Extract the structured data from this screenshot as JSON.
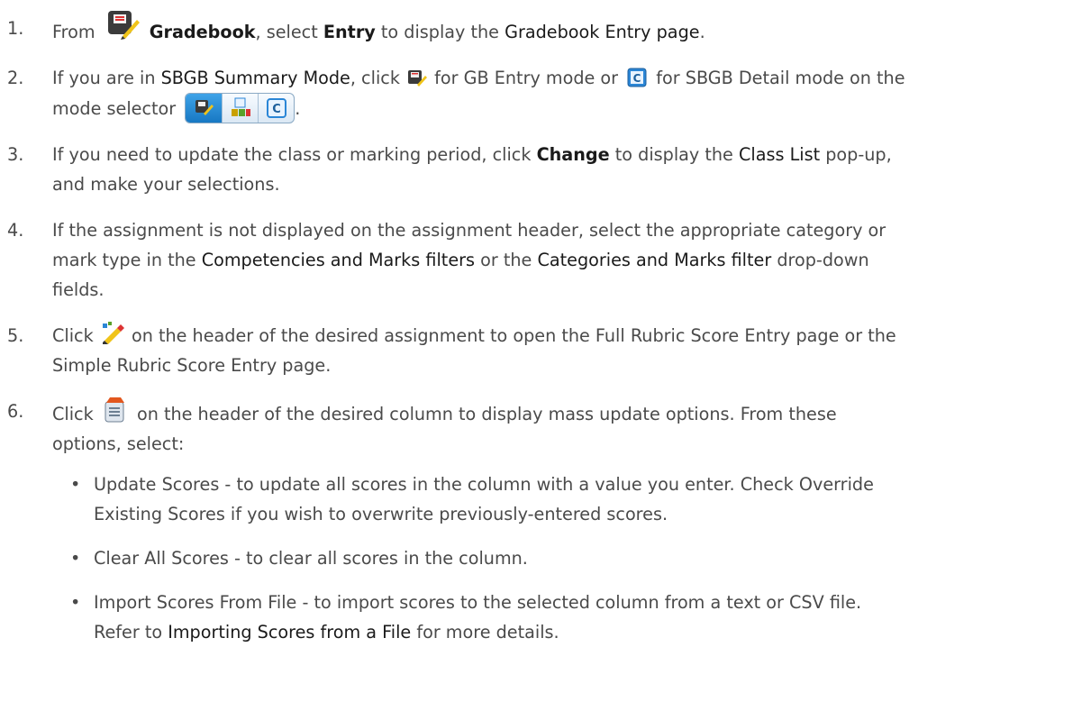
{
  "steps": [
    {
      "num": "1.",
      "from": "From",
      "gradebook": "Gradebook",
      "comma_select": ", select",
      "entry": "Entry",
      "to_display": "to display the",
      "page_link": "Gradebook Entry page",
      "end": "."
    },
    {
      "num": "2.",
      "if_in": "If you are in",
      "mode_link": "SBGB Summary Mode",
      "click": ", click",
      "for_gb": "for GB Entry mode or",
      "for_detail": "for SBGB Detail mode on the",
      "mode_selector": "mode selector",
      "end": "."
    },
    {
      "num": "3.",
      "line1a": "If you need to update the class or marking period, click",
      "change": "Change",
      "line1b": "to display the",
      "class_list": "Class List",
      "line1c": "pop-up,",
      "line2": "and make your selections."
    },
    {
      "num": "4.",
      "line1": "If the assignment is not displayed on the assignment header, select the appropriate category or",
      "line2a": "mark type in the",
      "comp_link": "Competencies and Marks filters",
      "or_the": "or the",
      "cat_link": "Categories and Marks filter",
      "line2b": "drop-down",
      "line3": "fields."
    },
    {
      "num": "5.",
      "click": "Click",
      "line1": "on the header of the desired assignment to open the Full Rubric Score Entry page or the",
      "line2": "Simple Rubric Score Entry page."
    },
    {
      "num": "6.",
      "click": "Click",
      "line1": "on the header of the desired column to display mass update options. From these",
      "line2": "options, select:"
    }
  ],
  "sub_items": [
    {
      "line1": "Update Scores - to update all scores in the column with a value you enter. Check Override",
      "line2": "Existing Scores if you wish to overwrite previously-entered scores."
    },
    {
      "line1": "Clear All Scores - to clear all scores in the column."
    },
    {
      "line1": "Import Scores From File - to import scores to the selected column from a text or CSV file.",
      "line2a": "Refer to",
      "link": "Importing Scores from a File",
      "line2b": "for more details."
    }
  ],
  "bullet": "•",
  "icons": {
    "gradebook": "gradebook-icon",
    "gb_entry_mode": "gb-entry-mode-icon",
    "sbgb_detail_mode": "sbgb-detail-mode-icon",
    "mode_selector": "mode-selector-icon",
    "rubric": "rubric-score-icon",
    "mass_update": "mass-update-icon"
  }
}
